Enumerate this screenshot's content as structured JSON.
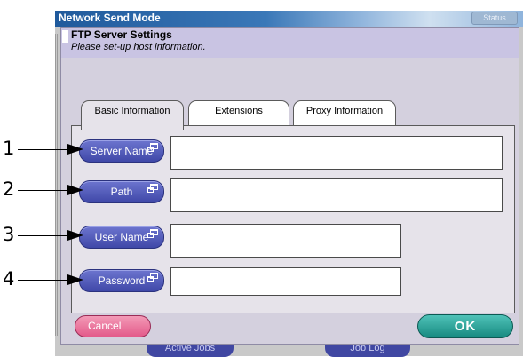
{
  "window": {
    "title": "Network Send Mode",
    "status_tab": "Status"
  },
  "dialog": {
    "title": "FTP Server Settings",
    "subtitle": "Please set-up host information."
  },
  "tabs": [
    {
      "label": "Basic Information",
      "selected": true
    },
    {
      "label": "Extensions",
      "selected": false
    },
    {
      "label": "Proxy Information",
      "selected": false
    }
  ],
  "fields": [
    {
      "label": "Server Name",
      "value": "",
      "callout": "1"
    },
    {
      "label": "Path",
      "value": "",
      "callout": "2"
    },
    {
      "label": "User Name",
      "value": "",
      "callout": "3"
    },
    {
      "label": "Password",
      "value": "",
      "callout": "4"
    }
  ],
  "buttons": {
    "cancel": "Cancel",
    "ok": "OK"
  },
  "footer_tabs": [
    "Active Jobs",
    "Job Log"
  ],
  "colors": {
    "field_button": "#4a53b5",
    "cancel": "#e8709a",
    "ok": "#22978d",
    "title_bar": "#205a9c"
  },
  "icons": {
    "field_button_glyph": "window-stack-icon"
  }
}
